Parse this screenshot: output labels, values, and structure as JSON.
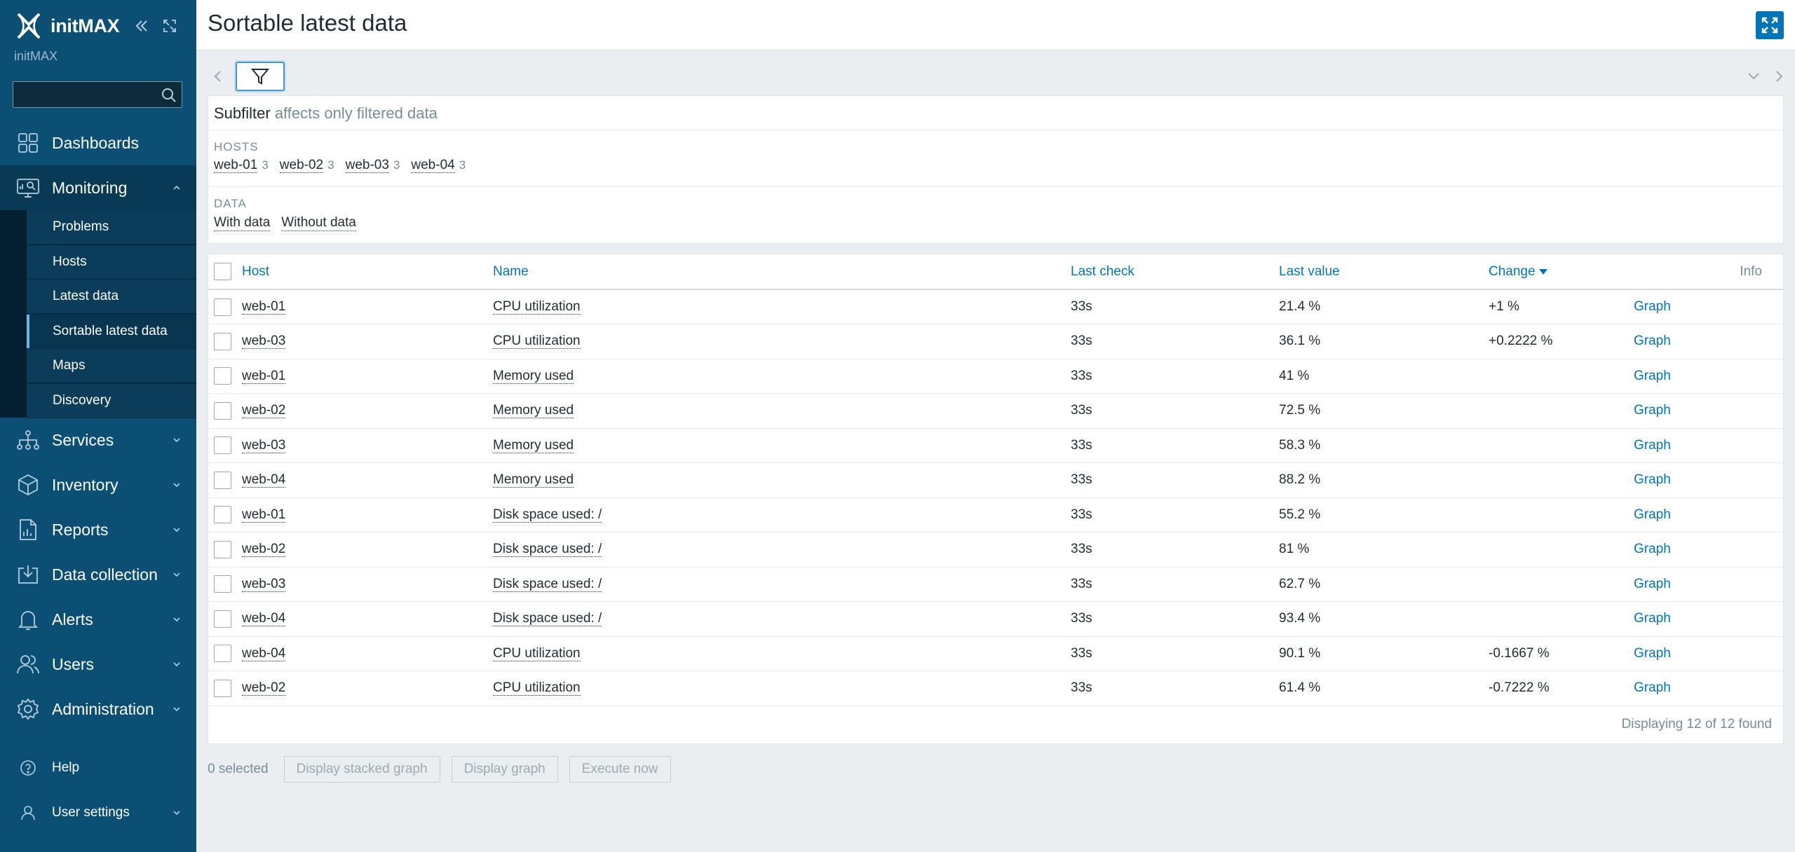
{
  "sidebar": {
    "logo_text": "initMAX",
    "server_name": "initMAX",
    "search": {
      "value": "",
      "placeholder": ""
    },
    "nav": [
      {
        "label": "Dashboards",
        "icon": "dashboards-icon"
      },
      {
        "label": "Monitoring",
        "icon": "monitoring-icon",
        "expanded": true
      },
      {
        "label": "Services",
        "icon": "services-icon"
      },
      {
        "label": "Inventory",
        "icon": "inventory-icon"
      },
      {
        "label": "Reports",
        "icon": "reports-icon"
      },
      {
        "label": "Data collection",
        "icon": "data-collection-icon"
      },
      {
        "label": "Alerts",
        "icon": "alerts-icon"
      },
      {
        "label": "Users",
        "icon": "users-icon"
      },
      {
        "label": "Administration",
        "icon": "administration-icon"
      }
    ],
    "monitoring_submenu": [
      "Problems",
      "Hosts",
      "Latest data",
      "Sortable latest data",
      "Maps",
      "Discovery"
    ],
    "selected_submenu": "Sortable latest data",
    "bottom": {
      "help": "Help",
      "user_settings": "User settings"
    }
  },
  "header": {
    "title": "Sortable latest data"
  },
  "subfilter": {
    "title": "Subfilter",
    "hint": "affects only filtered data",
    "hosts_label": "HOSTS",
    "hosts": [
      {
        "name": "web-01",
        "count": "3"
      },
      {
        "name": "web-02",
        "count": "3"
      },
      {
        "name": "web-03",
        "count": "3"
      },
      {
        "name": "web-04",
        "count": "3"
      }
    ],
    "data_label": "DATA",
    "data_options": [
      "With data",
      "Without data"
    ]
  },
  "table": {
    "columns": {
      "host": "Host",
      "name": "Name",
      "last_check": "Last check",
      "last_value": "Last value",
      "change": "Change",
      "info": "Info"
    },
    "rows": [
      {
        "host": "web-01",
        "name": "CPU utilization",
        "last_check": "33s",
        "last_value": "21.4 %",
        "change": "+1 %",
        "graph": "Graph"
      },
      {
        "host": "web-03",
        "name": "CPU utilization",
        "last_check": "33s",
        "last_value": "36.1 %",
        "change": "+0.2222 %",
        "graph": "Graph"
      },
      {
        "host": "web-01",
        "name": "Memory used",
        "last_check": "33s",
        "last_value": "41 %",
        "change": "",
        "graph": "Graph"
      },
      {
        "host": "web-02",
        "name": "Memory used",
        "last_check": "33s",
        "last_value": "72.5 %",
        "change": "",
        "graph": "Graph"
      },
      {
        "host": "web-03",
        "name": "Memory used",
        "last_check": "33s",
        "last_value": "58.3 %",
        "change": "",
        "graph": "Graph"
      },
      {
        "host": "web-04",
        "name": "Memory used",
        "last_check": "33s",
        "last_value": "88.2 %",
        "change": "",
        "graph": "Graph"
      },
      {
        "host": "web-01",
        "name": "Disk space used: /",
        "last_check": "33s",
        "last_value": "55.2 %",
        "change": "",
        "graph": "Graph"
      },
      {
        "host": "web-02",
        "name": "Disk space used: /",
        "last_check": "33s",
        "last_value": "81 %",
        "change": "",
        "graph": "Graph"
      },
      {
        "host": "web-03",
        "name": "Disk space used: /",
        "last_check": "33s",
        "last_value": "62.7 %",
        "change": "",
        "graph": "Graph"
      },
      {
        "host": "web-04",
        "name": "Disk space used: /",
        "last_check": "33s",
        "last_value": "93.4 %",
        "change": "",
        "graph": "Graph"
      },
      {
        "host": "web-04",
        "name": "CPU utilization",
        "last_check": "33s",
        "last_value": "90.1 %",
        "change": "-0.1667 %",
        "graph": "Graph"
      },
      {
        "host": "web-02",
        "name": "CPU utilization",
        "last_check": "33s",
        "last_value": "61.4 %",
        "change": "-0.7222 %",
        "graph": "Graph"
      }
    ],
    "displaying": "Displaying 12 of 12 found"
  },
  "footer": {
    "selected": "0 selected",
    "buttons": [
      "Display stacked graph",
      "Display graph",
      "Execute now"
    ]
  },
  "colors": {
    "sidebar": "#0b4f74",
    "accent": "#0275b8",
    "page_bg": "#ebeef0"
  }
}
